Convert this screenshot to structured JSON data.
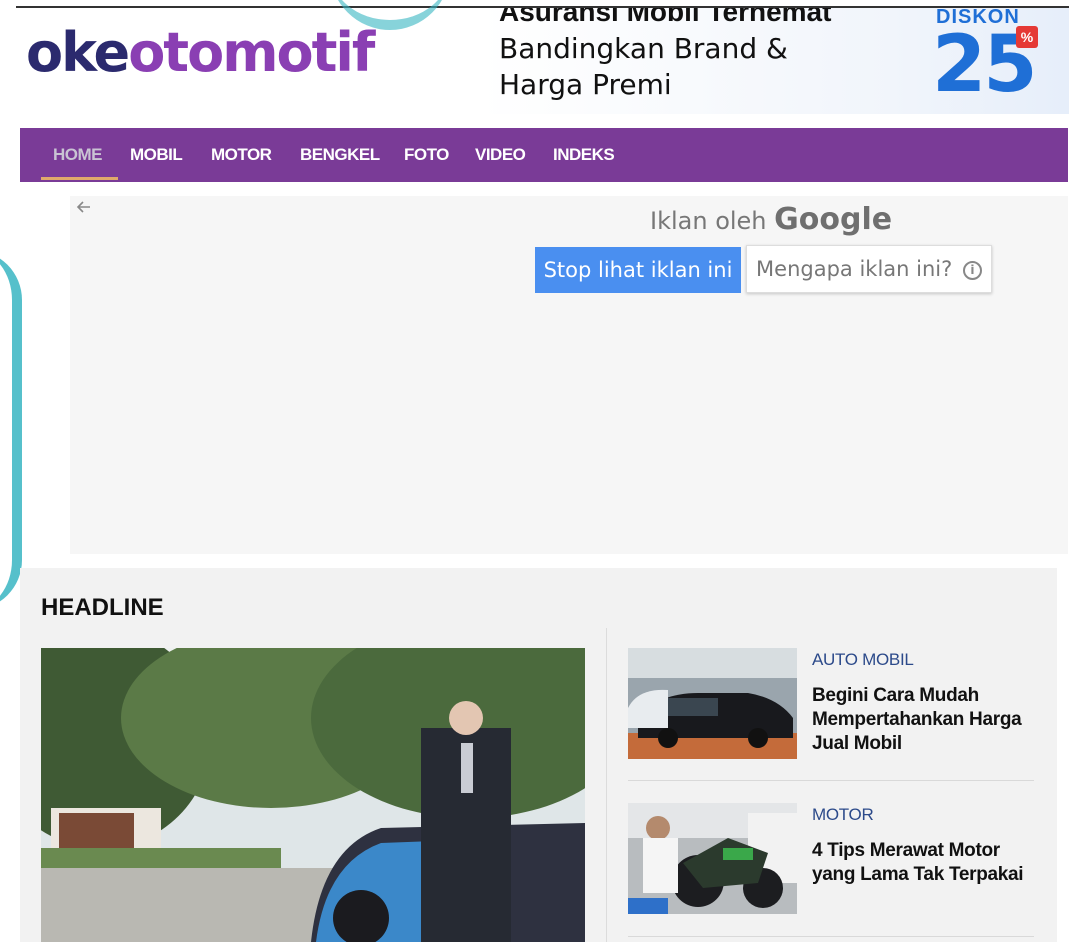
{
  "logo": {
    "part1": "oke",
    "part2": "otomotif"
  },
  "ad_banner": {
    "headline": "Asuransi Mobil Terhemat",
    "line1": "Bandingkan Brand &",
    "line2": "Harga Premi",
    "diskon_label": "DISKON",
    "diskon_value": "25",
    "percent_badge": "%"
  },
  "nav": {
    "items": [
      {
        "label": "HOME",
        "active": true
      },
      {
        "label": "MOBIL"
      },
      {
        "label": "MOTOR"
      },
      {
        "label": "BENGKEL"
      },
      {
        "label": "FOTO"
      },
      {
        "label": "VIDEO"
      },
      {
        "label": "INDEKS"
      }
    ],
    "color": "#7a3b97"
  },
  "google_ad": {
    "back_icon": "arrow-left-icon",
    "by_prefix": "Iklan oleh",
    "by_brand": "Google",
    "stop_button": "Stop lihat iklan ini",
    "why_button": "Mengapa iklan ini?",
    "info_icon": "ⓘ"
  },
  "headline": {
    "title": "HEADLINE",
    "side_items": [
      {
        "category": "AUTO MOBIL",
        "title": "Begini Cara Mudah Mempertahankan Harga Jual Mobil"
      },
      {
        "category": "MOTOR",
        "title": "4 Tips Merawat Motor yang Lama Tak Terpakai"
      }
    ]
  }
}
